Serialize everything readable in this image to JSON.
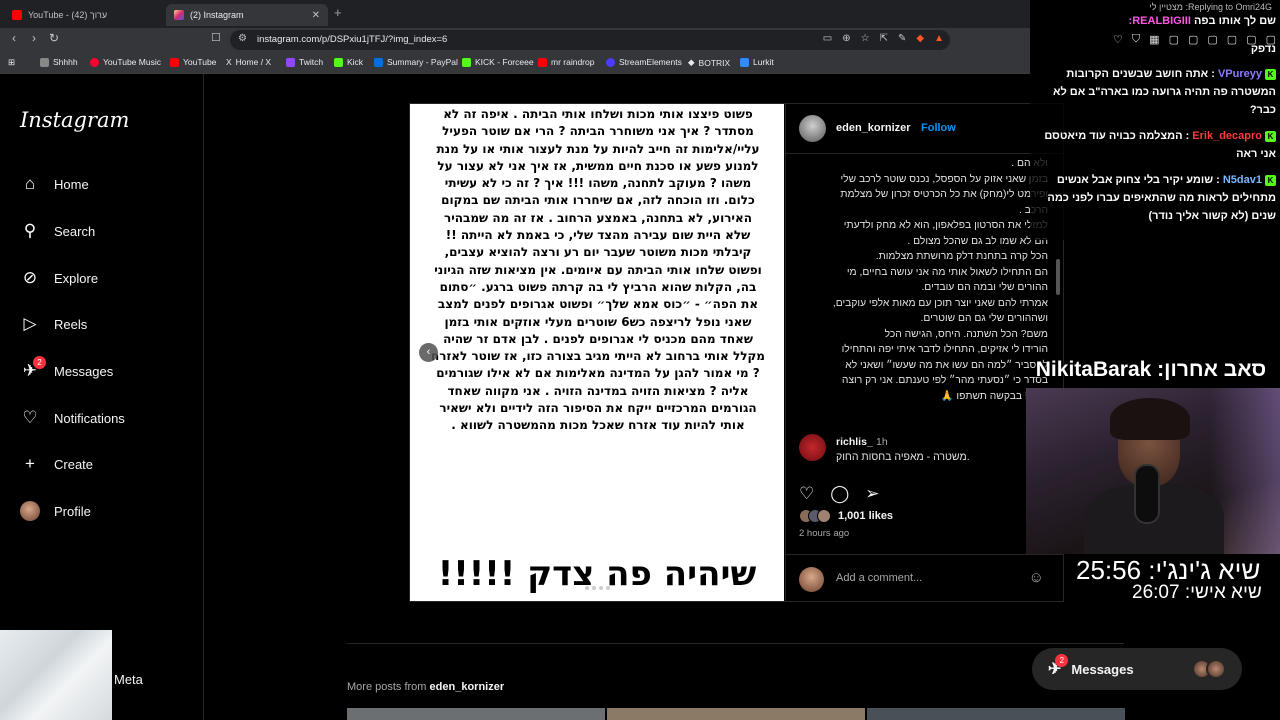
{
  "browser": {
    "tabs": [
      {
        "title": "YouTube - ערוך (42)",
        "favicon_color": "#ff0000"
      },
      {
        "title": "(2) Instagram",
        "favicon_color": "#d62976"
      }
    ],
    "url": "instagram.com/p/DSPxiu1jTFJ/?img_index=6",
    "bookmarks": [
      {
        "label": "Shhhh",
        "icon_color": "#888888"
      },
      {
        "label": "YouTube Music",
        "icon_color": "#ff0033"
      },
      {
        "label": "YouTube",
        "icon_color": "#ff0000"
      },
      {
        "label": "Home / X",
        "icon_color": "#ffffff"
      },
      {
        "label": "Twitch",
        "icon_color": "#9146ff"
      },
      {
        "label": "Kick",
        "icon_color": "#53fc18"
      },
      {
        "label": "Summary - PayPal",
        "icon_color": "#0070e0"
      },
      {
        "label": "KICK - Forceee",
        "icon_color": "#53fc18"
      },
      {
        "label": "mr raindrop",
        "icon_color": "#ff0000"
      },
      {
        "label": "StreamElements",
        "icon_color": "#4b3cff"
      },
      {
        "label": "BOTRIX",
        "icon_color": "#ffffff"
      },
      {
        "label": "Lurkit",
        "icon_color": "#2d8cff"
      }
    ]
  },
  "instagram": {
    "logo": "Instagram",
    "nav": [
      {
        "label": "Home",
        "icon": "home-icon"
      },
      {
        "label": "Search",
        "icon": "search-icon"
      },
      {
        "label": "Explore",
        "icon": "explore-icon"
      },
      {
        "label": "Reels",
        "icon": "reels-icon"
      },
      {
        "label": "Messages",
        "icon": "messages-icon",
        "badge": "2"
      },
      {
        "label": "Notifications",
        "icon": "heart-icon"
      },
      {
        "label": "Create",
        "icon": "plus-icon"
      },
      {
        "label": "Profile",
        "icon": "avatar"
      }
    ],
    "meta_label": "Meta"
  },
  "post": {
    "image_text": "פשוט פיצצו אותי מכות ושלחו אותי הביתה . איפה זה לא מסתדר ? איך אני משוחרר הביתה ? הרי אם שוטר הפעיל עליי/אלימות זה חייב להיות על מנת לעצור אותי או על מנת למנוע פשע או סכנת חיים ממשית, אז איך אני לא עצור על משהו ? מעוקב לתחנה, משהו !!! איך ? זה כי לא עשיתי כלום. וזו הוכחה לזה, אם שיחררו אותי הביתה שם במקום האירוע, לא בתחנה, באמצע הרחוב . אז זה מה שמבהיר שלא היית שום עבירה מהצד שלי, כי באמת לא הייתה !! קיבלתי מכות משוטר שעבר יום רע ורצה להוציא עצבים, ופשוט שלחו אותי הביתה עם איומים. אין מציאות שזה הגיוני בה, הקלות שהוא הרביץ לי בה קרתה פשוט ברגע. ״סתום את הפה״ - ״כוס אמא שלך״ ופשוט אגרופים לפנים למצב שאני נופל לריצפה כש6 שוטרים מעלי אוזקים אותי בזמן שאחד מהם מכניס לי אגרופים לפנים . לבן אדם זר שהיה מקלל אותי ברחוב לא הייתי מגיב בצורה כזו, אז שוטר לאזרח ? מי אמור להגן על המדינה מאלימות אם לא אילו שגורמים אליה ? מציאות הזויה במדינה הזויה . אני מקווה שאחד הגורמים המרכזיים ייקח את הסיפור הזה לידיים ולא ישאיר אותי להיות עוד אזרח שאכל מכות מהמשטרה לשווא .",
    "slogan": "שיהיה פה צדק !!!!!",
    "author": "eden_kornizer",
    "follow_label": "Follow",
    "caption": "ולא הם .\nבזמן שאני אזוק על הספסל, נכנס שוטר לרכב שלי ופירמט לי(מחק) את כל הכרטיס זכרון של מצלמת הרכב .\nלמזלי את הסרטון בפלאפון, הוא לא מחק ולדעתי הם לא שמו לב גם שהכל מצולם .\nהכל קרה בתחנת דלק מרושתת מצלמות.\nהם התחילו לשאול אותי מה אני עושה בחיים, מי ההורים שלי ובמה הם עובדים.\nאמרתי להם שאני יוצר תוכן עם מאות אלפי עוקבים, ושההורים שלי גם הם שוטרים.\nמשם? הכל השתנה. היחס, הגישה הכל\nהורידו לי אזיקים, התחילו לדבר איתי יפה והתחילו להסביר ״למה הם עשו את מה שעשו״ ושאני לא בסדר כי ״נסעתי מהר״ לפי טענתם. אני רק רוצה צדק ! בבקשה תשתפו 🙏",
    "comment": {
      "user": "richlis_",
      "time": "1h",
      "text": "משטרה - מאפיה בחסות החוק."
    },
    "likes": "1,001 likes",
    "posted": "2 hours ago",
    "add_comment_placeholder": "Add a comment...",
    "more_from_prefix": "More posts from",
    "more_from_user": "eden_kornizer"
  },
  "floating_messages": {
    "label": "Messages",
    "badge": "2"
  },
  "stream_overlay": {
    "reply_to": "Replying to Omri24G: מצטיין לי",
    "first_line_text": "שם לך אותו בפה",
    "first_line_user": "REALBIGIII:",
    "chat_messages": [
      {
        "user": "",
        "text": "נדפק"
      },
      {
        "user": "VPureyy",
        "user_class": "u1",
        "text": "אתה חושב שבשנים הקרובות המשטרה פה תהיה גרועה כמו בארה\"ב אם לא כבר?"
      },
      {
        "user": "Erik_decapro",
        "user_class": "u2",
        "text": "המצלמה כבויה עוד מיאטסם אני ראה"
      },
      {
        "user": "N5dav1",
        "user_class": "u3",
        "text": "שומע יקיר בלי צחוק אבל אנשים מתחילים לראות מה שהתאיפים עברו לפני כמה שנים (לא קשור אליך נודר)"
      }
    ],
    "cam_title": "סאב אחרון: NikitaBarak",
    "timer_primary": "שיא ג'ינג'י: 25:56",
    "timer_secondary": "שיא אישי: 26:07"
  }
}
